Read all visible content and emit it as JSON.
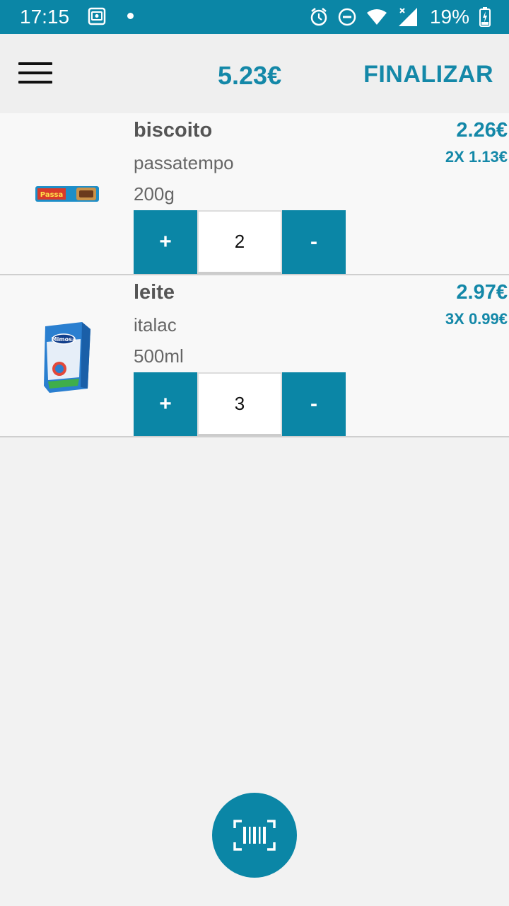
{
  "status_bar": {
    "time": "17:15",
    "battery": "19%",
    "icons": [
      "screenshot-icon",
      "notification-dot-icon",
      "alarm-icon",
      "do-not-disturb-icon",
      "wifi-icon",
      "signal-icon",
      "battery-charging-icon"
    ]
  },
  "app_bar": {
    "total": "5.23€",
    "finalize_label": "FINALIZAR",
    "menu_icon": "hamburger-menu-icon"
  },
  "items": [
    {
      "name": "biscoito",
      "brand": "passatempo",
      "size": "200g",
      "total": "2.26€",
      "unit_price": "2X 1.13€",
      "quantity": "2",
      "plus_label": "+",
      "minus_label": "-",
      "image_icon": "cookie-package-image"
    },
    {
      "name": "leite",
      "brand": "italac",
      "size": "500ml",
      "total": "2.97€",
      "unit_price": "3X 0.99€",
      "quantity": "3",
      "plus_label": "+",
      "minus_label": "-",
      "image_icon": "milk-carton-image"
    }
  ],
  "fab": {
    "icon": "barcode-scan-icon"
  },
  "colors": {
    "accent": "#0b86a6",
    "accent_text": "#1488a8",
    "background": "#f2f2f2"
  }
}
